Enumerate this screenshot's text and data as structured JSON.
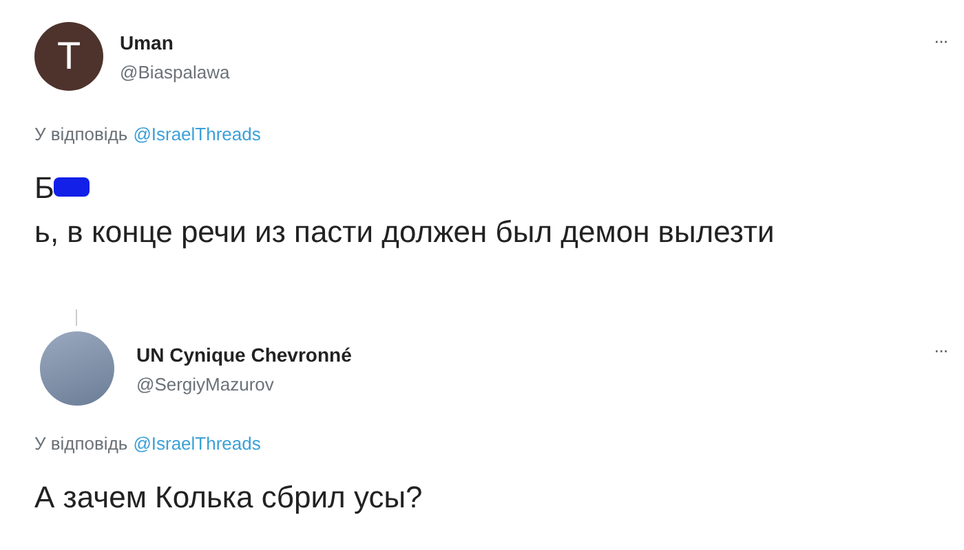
{
  "tweets": [
    {
      "avatar": {
        "kind": "letter",
        "letter": "T"
      },
      "name": "Uman",
      "handle": "@Biaspalawa",
      "more": "···",
      "reply_prefix": "У відповідь",
      "reply_to": "@IsraelThreads",
      "thread_line": false,
      "body": [
        {
          "kind": "text",
          "text": "Б"
        },
        {
          "kind": "censor"
        },
        {
          "kind": "text",
          "text": "ь, в конце речи из пасти должен был демон"
        },
        {
          "kind": "text",
          "text": "вылезти"
        }
      ]
    },
    {
      "avatar": {
        "kind": "photo"
      },
      "name": "UN Cynique Chevronné",
      "handle": "@SergiyMazurov",
      "more": "···",
      "reply_prefix": "У відповідь",
      "reply_to": "@IsraelThreads",
      "thread_line": true,
      "body": [
        {
          "kind": "text",
          "text": "А зачем Колька сбрил усы?"
        }
      ]
    }
  ]
}
